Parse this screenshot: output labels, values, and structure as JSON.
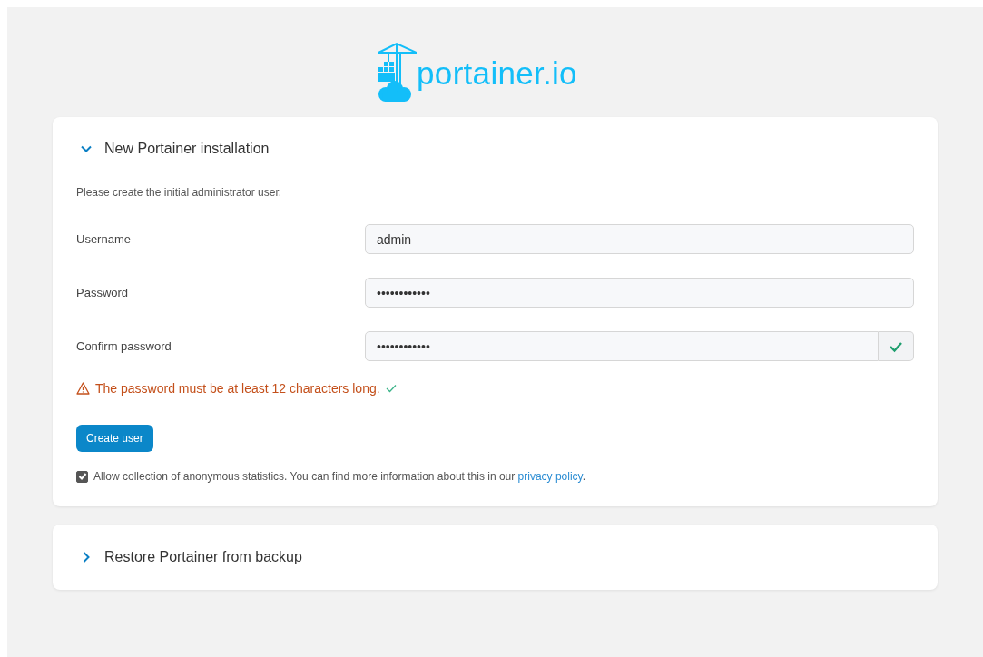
{
  "logo": {
    "text": "portainer.io"
  },
  "panels": [
    {
      "kind": "form",
      "title": "New Portainer installation",
      "expanded": true,
      "intro": "Please create the initial administrator user.",
      "fields": [
        {
          "label": "Username",
          "value": "admin",
          "valid": false
        },
        {
          "label": "Password",
          "value": "••••••••••••",
          "valid": false
        },
        {
          "label": "Confirm password",
          "value": "••••••••••••",
          "valid": true
        }
      ],
      "warning": {
        "text": "The password must be at least 12 characters long.",
        "met": true
      },
      "submit": "Create user",
      "consent": {
        "checked": true,
        "text": "Allow collection of anonymous statistics. You can find more information about this in our",
        "link": "privacy policy",
        "after": "."
      }
    },
    {
      "kind": "restore",
      "title": "Restore Portainer from backup",
      "expanded": false
    }
  ]
}
